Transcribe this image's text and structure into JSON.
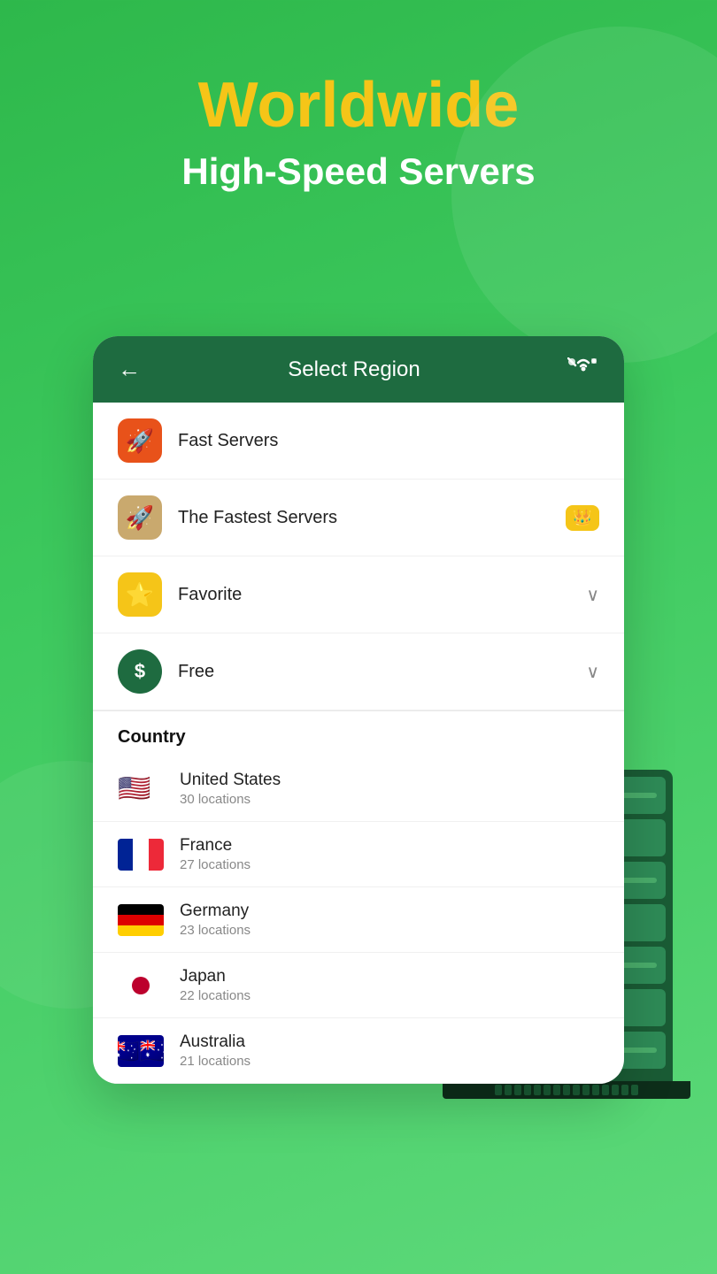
{
  "header": {
    "title_line1": "Worldwide",
    "title_line2": "High-Speed Servers"
  },
  "card": {
    "header": {
      "back_label": "←",
      "title": "Select Region",
      "wifi_icon": "wifi-x"
    },
    "menu_items": [
      {
        "id": "fast-servers",
        "icon": "🚀",
        "icon_bg": "orange",
        "label": "Fast Servers",
        "right": ""
      },
      {
        "id": "fastest-servers",
        "icon": "🚀",
        "icon_bg": "tan",
        "label": "The Fastest Servers",
        "right": "crown"
      },
      {
        "id": "favorite",
        "icon": "⭐",
        "icon_bg": "yellow",
        "label": "Favorite",
        "right": "chevron"
      },
      {
        "id": "free",
        "icon": "$",
        "icon_bg": "green",
        "label": "Free",
        "right": "chevron"
      }
    ],
    "country_heading": "Country",
    "countries": [
      {
        "id": "us",
        "name": "United States",
        "locations": "30 locations",
        "flag": "us"
      },
      {
        "id": "fr",
        "name": "France",
        "locations": "27 locations",
        "flag": "fr"
      },
      {
        "id": "de",
        "name": "Germany",
        "locations": "23 locations",
        "flag": "de"
      },
      {
        "id": "jp",
        "name": "Japan",
        "locations": "22 locations",
        "flag": "jp"
      },
      {
        "id": "au",
        "name": "Australia",
        "locations": "21 locations",
        "flag": "au"
      }
    ]
  },
  "colors": {
    "bg_gradient_start": "#2eb84b",
    "bg_gradient_end": "#5dd97a",
    "title_yellow": "#f5c518",
    "card_header_bg": "#1e6b40",
    "accent_green": "#3dc95e"
  }
}
